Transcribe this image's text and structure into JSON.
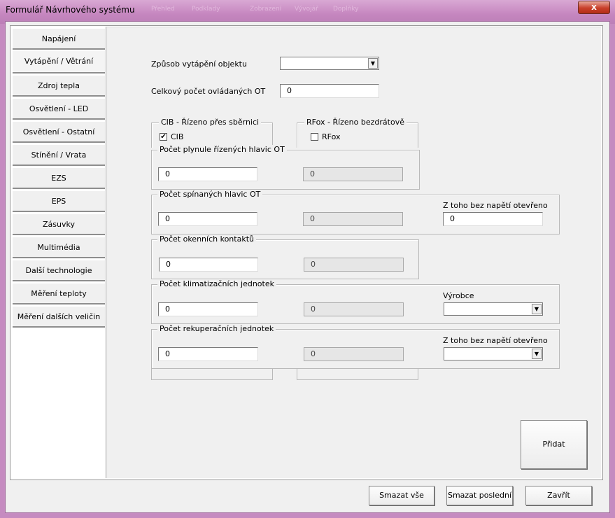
{
  "window": {
    "title": "Formulář Návrhového systému",
    "ghost_tabs": [
      "Přehled",
      "Podklady",
      "Zobrazení",
      "Vývojář",
      "Doplňky"
    ],
    "close_label": "x"
  },
  "sidebar": {
    "items": [
      {
        "label": "Napájení",
        "active": false
      },
      {
        "label": "Vytápění / Větrání",
        "active": true
      },
      {
        "label": "Zdroj tepla",
        "active": false
      },
      {
        "label": "Osvětlení - LED",
        "active": false
      },
      {
        "label": "Osvětlení - Ostatní",
        "active": false
      },
      {
        "label": "Stínění / Vrata",
        "active": false
      },
      {
        "label": "EZS",
        "active": false
      },
      {
        "label": "EPS",
        "active": false
      },
      {
        "label": "Zásuvky",
        "active": false
      },
      {
        "label": "Multimédia",
        "active": false
      },
      {
        "label": "Další technologie",
        "active": false
      },
      {
        "label": "Měření teploty",
        "active": false
      },
      {
        "label": "Měření dalších veličin",
        "active": false
      }
    ]
  },
  "form": {
    "heating_method": {
      "label": "Způsob vytápění objektu",
      "value": ""
    },
    "total_ot": {
      "label": "Celkový počet ovládaných OT",
      "value": "0"
    },
    "cib_group": {
      "caption": "CIB - Řízeno přes sběrnici",
      "checkbox_label": "CIB",
      "checked": true,
      "check_glyph": "✔"
    },
    "rfox_group": {
      "caption": "RFox - Řízeno bezdrátově",
      "checkbox_label": "RFox",
      "checked": false
    },
    "smooth_heads": {
      "caption": "Počet plynule řízených hlavic OT",
      "value": "0",
      "computed": "0"
    },
    "switched_heads": {
      "caption": "Počet spínaných hlavic OT",
      "value": "0",
      "computed": "0",
      "extra_label": "Z toho bez napětí otevřeno",
      "extra_value": "0"
    },
    "window_contacts": {
      "caption": "Počet okenních kontaktů",
      "value": "0",
      "computed": "0"
    },
    "ac_units": {
      "caption": "Počet klimatizačních jednotek",
      "value": "0",
      "computed": "0",
      "extra_label": "Výrobce",
      "extra_value": ""
    },
    "recup_units": {
      "caption": "Počet rekuperačních jednotek",
      "value": "0",
      "computed": "0",
      "extra_label": "Z toho bez napětí otevřeno",
      "extra_value": ""
    },
    "add_button": "Přidat"
  },
  "footer": {
    "clear_all": "Smazat vše",
    "clear_last": "Smazat poslední",
    "close": "Zavřít"
  }
}
